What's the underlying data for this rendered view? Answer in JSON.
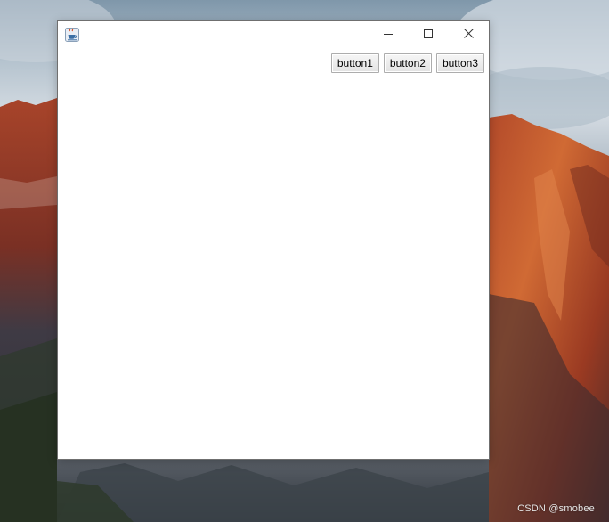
{
  "desktop": {
    "wallpaper": "mountain-cliff-sunset",
    "watermark": "CSDN @smobee"
  },
  "window": {
    "icon": "java-cup-icon",
    "controls": {
      "minimize_icon": "minimize-icon",
      "maximize_icon": "maximize-icon",
      "close_icon": "close-icon"
    },
    "background_color": "#ffffff",
    "buttons": [
      {
        "label": "button1"
      },
      {
        "label": "button2"
      },
      {
        "label": "button3"
      }
    ]
  }
}
